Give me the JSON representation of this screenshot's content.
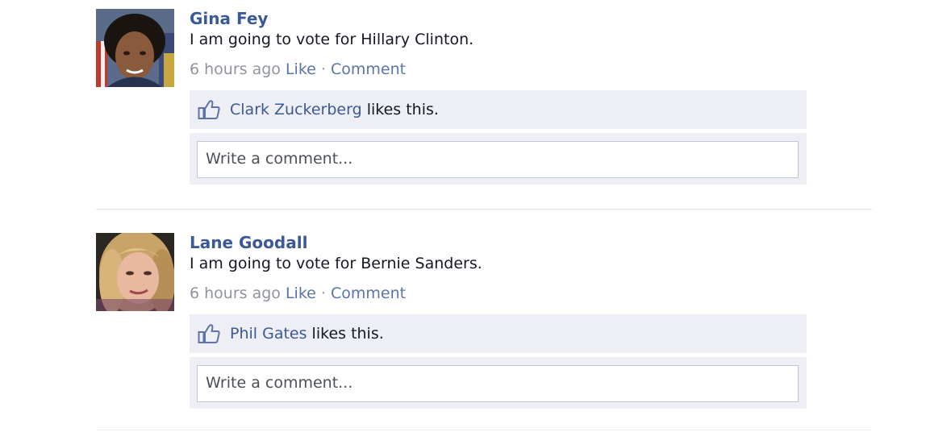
{
  "posts": [
    {
      "author": "Gina Fey",
      "status": "I am going to vote for Hillary Clinton.",
      "time": "6 hours ago",
      "like_label": "Like",
      "separator": "·",
      "comment_label": "Comment",
      "liker": "Clark Zuckerberg",
      "likes_suffix": " likes this.",
      "comment_placeholder": "Write a comment..."
    },
    {
      "author": "Lane Goodall",
      "status": "I am going to vote for Bernie Sanders.",
      "time": "6 hours ago",
      "like_label": "Like",
      "separator": "·",
      "comment_label": "Comment",
      "liker": "Phil Gates",
      "likes_suffix": " likes this.",
      "comment_placeholder": "Write a comment..."
    }
  ],
  "colors": {
    "link_blue": "#3b5998",
    "muted_gray": "#90949c",
    "panel_bg": "#edeff4"
  },
  "icons": {
    "like": "thumbs-up-icon"
  }
}
